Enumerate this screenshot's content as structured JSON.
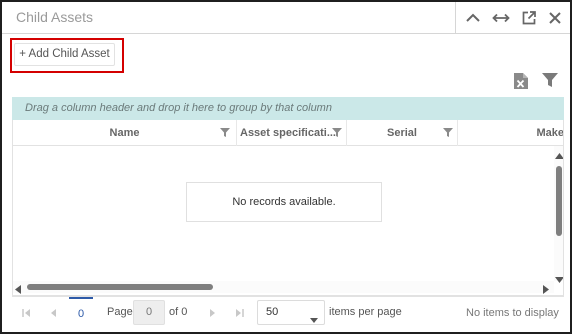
{
  "window": {
    "title": "Child Assets",
    "buttons": [
      {
        "name": "collapse",
        "icon": "chevron-up-icon"
      },
      {
        "name": "resize",
        "icon": "horizontal-arrows-icon"
      },
      {
        "name": "popout",
        "icon": "external-link-icon"
      },
      {
        "name": "close",
        "icon": "close-icon"
      }
    ]
  },
  "toolbar": {
    "add_label": "+ Add Child Asset",
    "export_icon": "excel-export-icon",
    "filter_icon": "filter-icon"
  },
  "group_hint": "Drag a column header and drop it here to group by that column",
  "grid": {
    "columns": [
      {
        "label": "Name",
        "filter": true
      },
      {
        "label": "Asset specificati...",
        "filter": true
      },
      {
        "label": "Serial",
        "filter": true
      },
      {
        "label": "Make",
        "filter": false
      }
    ],
    "empty_message": "No records available."
  },
  "pager": {
    "current_page": "0",
    "page_label": "Page",
    "page_input": "0",
    "of_label": "of 0",
    "page_size": "50",
    "items_per_page_label": "items per page",
    "status": "No items to display"
  },
  "colors": {
    "highlight": "#d40000",
    "group_bar": "#cbe8e8",
    "pager_accent": "#2d5aa8"
  }
}
